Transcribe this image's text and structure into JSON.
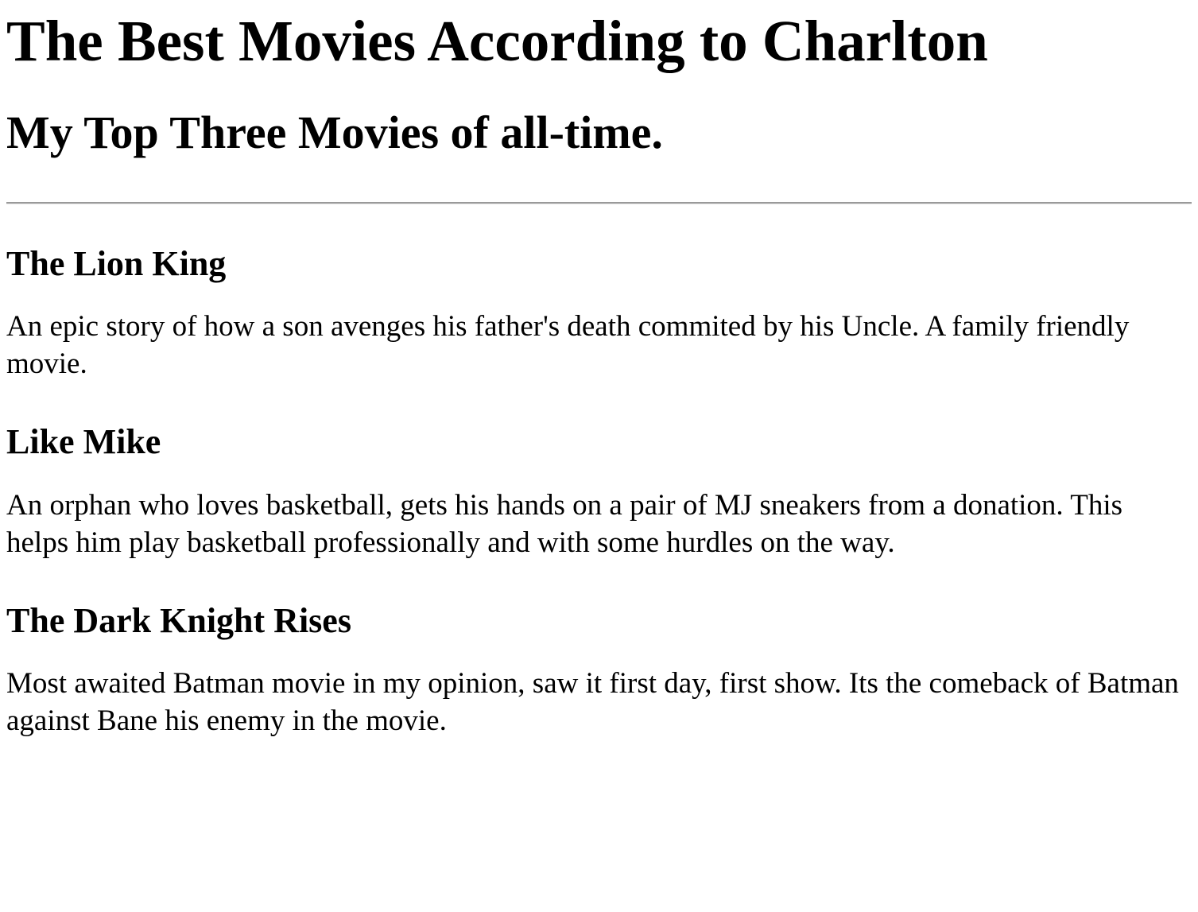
{
  "page": {
    "title": "The Best Movies According to Charlton",
    "subtitle": "My Top Three Movies of all-time."
  },
  "movies": [
    {
      "title": "The Lion King",
      "description": "An epic story of how a son avenges his father's death commited by his Uncle. A family friendly movie."
    },
    {
      "title": "Like Mike",
      "description": "An orphan who loves basketball, gets his hands on a pair of MJ sneakers from a donation. This helps him play basketball professionally and with some hurdles on the way."
    },
    {
      "title": "The Dark Knight Rises",
      "description": "Most awaited Batman movie in my opinion, saw it first day, first show. Its the comeback of Batman against Bane his enemy in the movie."
    }
  ]
}
